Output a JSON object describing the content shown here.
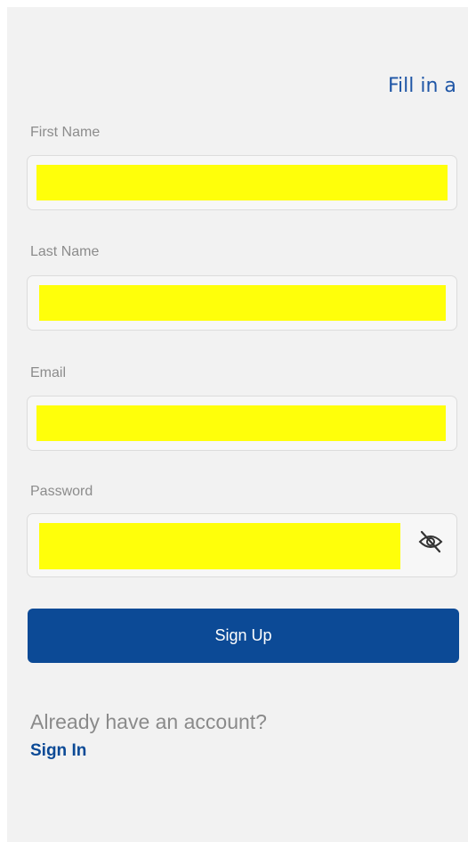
{
  "banner": {
    "text": "Fill in a"
  },
  "form": {
    "first_name": {
      "label": "First Name",
      "value": ""
    },
    "last_name": {
      "label": "Last Name",
      "value": ""
    },
    "email": {
      "label": "Email",
      "value": ""
    },
    "password": {
      "label": "Password",
      "value": "",
      "toggle_icon": "eye-slash-icon"
    }
  },
  "actions": {
    "signup_label": "Sign Up",
    "already_text": "Already have an account?",
    "signin_label": "Sign In"
  },
  "colors": {
    "accent": "#0c4a96",
    "banner": "#1f56a6",
    "redaction": "#ffff0a",
    "background": "#f2f2f2"
  }
}
